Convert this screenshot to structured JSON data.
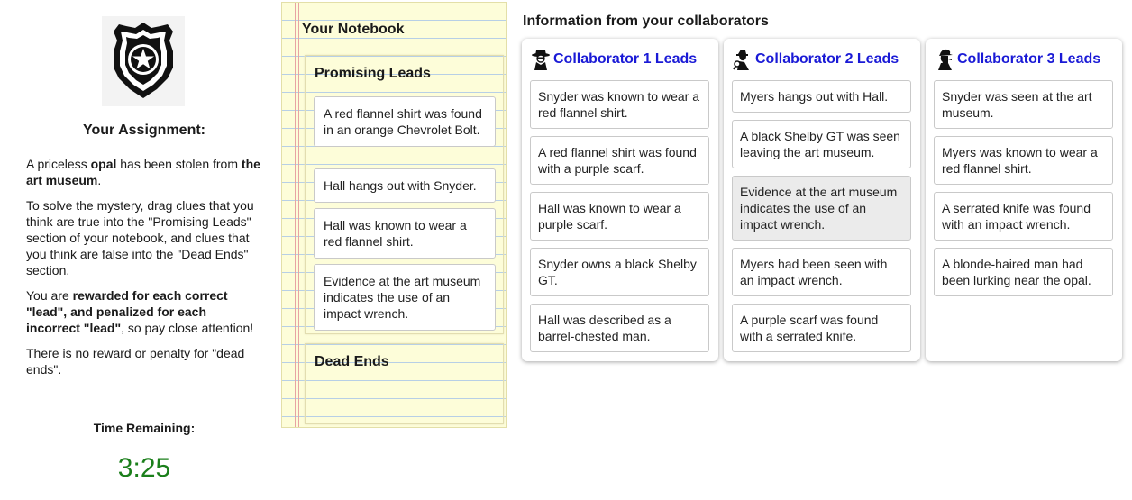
{
  "assignment": {
    "title": "Your Assignment:",
    "intro": {
      "pre": "A priceless ",
      "item": "opal",
      "mid": " has been stolen from ",
      "place": "the art museum",
      "post": "."
    },
    "instructions": "To solve the mystery, drag clues that you think are true into the \"Promising Leads\" section of your notebook, and clues that you think are false into the \"Dead Ends\" section.",
    "reward": {
      "pre": "You are ",
      "bold": "rewarded for each correct \"lead\", and penalized for each incorrect \"lead\"",
      "post": ", so pay close attention!"
    },
    "note": "There is no reward or penalty for \"dead ends\".",
    "time_label": "Time Remaining:",
    "time_value": "3:25",
    "badge_icon": "police-badge-icon"
  },
  "notebook": {
    "title": "Your Notebook",
    "promising_title": "Promising Leads",
    "promising_leads": [
      "A red flannel shirt was found in an orange Chevrolet Bolt.",
      "Hall hangs out with Snyder.",
      "Hall was known to wear a red flannel shirt.",
      "Evidence at the art museum indicates the use of an impact wrench."
    ],
    "dead_ends_title": "Dead Ends",
    "dead_ends": []
  },
  "collaborators": {
    "title": "Information from your collaborators",
    "columns": [
      {
        "name": "Collaborator 1 Leads",
        "icon": "spy-fedora-icon",
        "clues": [
          "Snyder was known to wear a red flannel shirt.",
          "A red flannel shirt was found with a purple scarf.",
          "Hall was known to wear a purple scarf.",
          "Snyder owns a black Shelby GT.",
          "Hall was described as a barrel-chested man."
        ]
      },
      {
        "name": "Collaborator 2 Leads",
        "icon": "detective-magnifier-icon",
        "clues": [
          "Myers hangs out with Hall.",
          "A black Shelby GT was seen leaving the art museum.",
          "Evidence at the art museum indicates the use of an impact wrench.",
          "Myers had been seen with an impact wrench.",
          "A purple scarf was found with a serrated knife."
        ]
      },
      {
        "name": "Collaborator 3 Leads",
        "icon": "sherlock-silhouette-icon",
        "clues": [
          "Snyder was seen at the art museum.",
          "Myers was known to wear a red flannel shirt.",
          "A serrated knife was found with an impact wrench.",
          "A blonde-haired man had been lurking near the opal."
        ]
      }
    ]
  },
  "colors": {
    "link": "#1a1ad6",
    "timer": "#1b7f1b",
    "paper": "#fdfdd9",
    "rule": "#b7cfe6",
    "margin": "#e8a3a3"
  }
}
